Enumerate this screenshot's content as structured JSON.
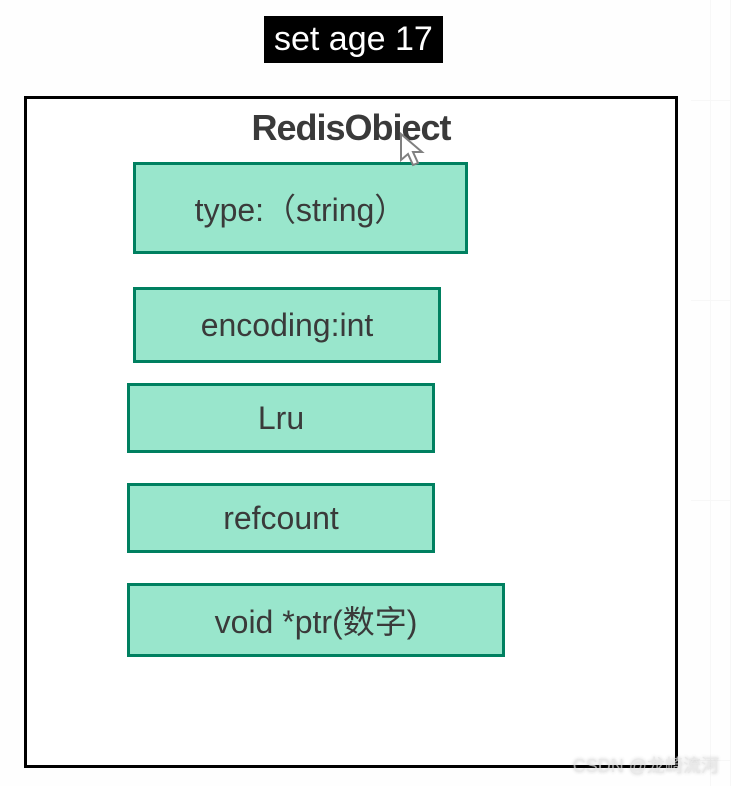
{
  "command": "set age 17",
  "title": "RedisObiect",
  "fields": {
    "type": "type:（string）",
    "encoding": "encoding:int",
    "lru": "Lru",
    "refcount": "refcount",
    "ptr": "void *ptr(数字)"
  },
  "watermark": "CSDN @龙崎流河"
}
